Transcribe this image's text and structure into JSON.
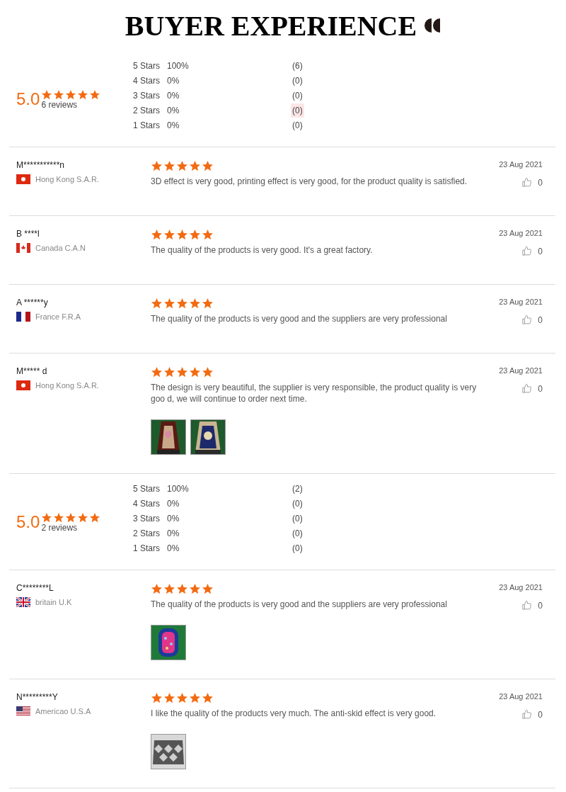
{
  "title": "BUYER EXPERIENCE",
  "sections": [
    {
      "summary": {
        "score": "5.0",
        "stars": 5,
        "count": "6 reviews",
        "rows": [
          {
            "label": "5 Stars",
            "percent": "100%",
            "count": "(6)",
            "highlighted": false
          },
          {
            "label": "4 Stars",
            "percent": "0%",
            "count": "(0)",
            "highlighted": false
          },
          {
            "label": "3 Stars",
            "percent": "0%",
            "count": "(0)",
            "highlighted": false
          },
          {
            "label": "2 Stars",
            "percent": "0%",
            "count": "(0)",
            "highlighted": true
          },
          {
            "label": "1 Stars",
            "percent": "0%",
            "count": "(0)",
            "highlighted": false
          }
        ]
      },
      "reviews": [
        {
          "name": "M***********n",
          "flag": {
            "kind": "hk"
          },
          "country": "Hong Kong S.A.R.",
          "stars": 5,
          "text": "3D effect is very good, printing effect is very good, for the product quality is satisfied.",
          "date": "23 Aug 2021",
          "likes": "0"
        },
        {
          "name": "B ****l",
          "flag": {
            "kind": "ca"
          },
          "country": "Canada C.A.N",
          "stars": 5,
          "text": "The quality of the products is very good. It's a great factory.",
          "date": "23 Aug 2021",
          "likes": "0"
        },
        {
          "name": "A ******y",
          "flag": {
            "kind": "fr"
          },
          "country": "France  F.R.A",
          "stars": 5,
          "text": "The quality of the products is very good and the suppliers are very professional",
          "date": "23 Aug 2021",
          "likes": "0"
        },
        {
          "name": "M***** d",
          "flag": {
            "kind": "hk"
          },
          "country": "Hong Kong S.A.R.",
          "stars": 5,
          "text": "The design is very beautiful, the supplier is very responsible, the product quality is very goo d, we will continue to order next time.",
          "date": "23 Aug 2021",
          "likes": "0",
          "photos": [
            {
              "kind": "picture"
            },
            {
              "kind": "picture"
            }
          ]
        }
      ]
    },
    {
      "summary": {
        "score": "5.0",
        "stars": 5,
        "count": "2 reviews",
        "rows": [
          {
            "label": "5 Stars",
            "percent": "100%",
            "count": "(2)",
            "highlighted": false
          },
          {
            "label": "4 Stars",
            "percent": "0%",
            "count": "(0)",
            "highlighted": false
          },
          {
            "label": "3 Stars",
            "percent": "0%",
            "count": "(0)",
            "highlighted": false
          },
          {
            "label": "2 Stars",
            "percent": "0%",
            "count": "(0)",
            "highlighted": false
          },
          {
            "label": "1 Stars",
            "percent": "0%",
            "count": "(0)",
            "highlighted": false
          }
        ]
      },
      "reviews": [
        {
          "name": "C********L",
          "flag": {
            "kind": "uk"
          },
          "country": "britain U.K",
          "stars": 5,
          "text": "The quality of the products is very good and the suppliers are very professional",
          "date": "23 Aug 2021",
          "likes": "0",
          "photos": [
            {
              "kind": "picture"
            }
          ]
        },
        {
          "name": "N*********Y",
          "flag": {
            "kind": "us"
          },
          "country": "Americao U.S.A",
          "stars": 5,
          "text": "I like the quality of the products very much. The anti-skid effect is very good.",
          "date": "23 Aug 2021",
          "likes": "0",
          "photos": [
            {
              "kind": "picture"
            }
          ]
        }
      ]
    }
  ]
}
